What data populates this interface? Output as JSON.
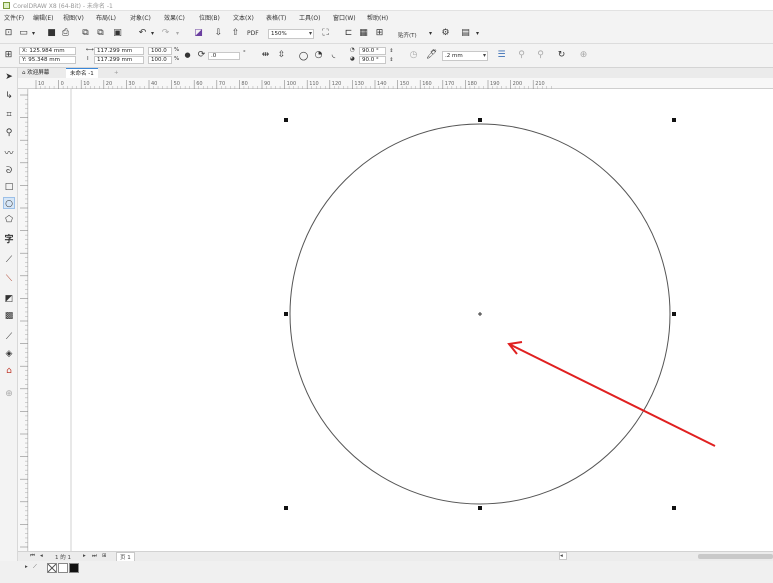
{
  "window": {
    "title": "CorelDRAW X8 (64-Bit) - 未命名 -1"
  },
  "menubar": {
    "items": [
      {
        "label": "文件(F)",
        "name": "menu-file"
      },
      {
        "label": "编辑(E)",
        "name": "menu-edit"
      },
      {
        "label": "视图(V)",
        "name": "menu-view"
      },
      {
        "label": "布局(L)",
        "name": "menu-layout"
      },
      {
        "label": "对象(C)",
        "name": "menu-object"
      },
      {
        "label": "效果(C)",
        "name": "menu-effects"
      },
      {
        "label": "位图(B)",
        "name": "menu-bitmaps"
      },
      {
        "label": "文本(X)",
        "name": "menu-text"
      },
      {
        "label": "表格(T)",
        "name": "menu-table"
      },
      {
        "label": "工具(O)",
        "name": "menu-tools"
      },
      {
        "label": "窗口(W)",
        "name": "menu-window"
      },
      {
        "label": "帮助(H)",
        "name": "menu-help"
      }
    ]
  },
  "toolbar": {
    "zoom": "150%",
    "snap_label": "贴齐(T)"
  },
  "propbar": {
    "x": "X: 125.984 mm",
    "y": "Y: 95.348 mm",
    "width": "117.299 mm",
    "height": "117.299 mm",
    "scale_w": "100.0",
    "scale_h": "100.0",
    "percent": "%",
    "rotation": ".0",
    "degree": "°",
    "start_angle": "90.0 °",
    "end_angle": "90.0 °",
    "outline_width": ".2 mm"
  },
  "doctabs": {
    "welcome": "欢迎屏幕",
    "document": "未命名 -1",
    "add": "+"
  },
  "ruler": {
    "h_labels": [
      "10",
      "0",
      "10",
      "20",
      "30",
      "40",
      "50",
      "60",
      "70",
      "80",
      "90",
      "100",
      "110",
      "120",
      "130",
      "140",
      "150",
      "160",
      "170",
      "180",
      "190",
      "200",
      "210"
    ],
    "unit": "毫米"
  },
  "pagebar": {
    "page_count": "1 的 1",
    "page_tab": "页 1"
  },
  "status": {
    "text": ""
  },
  "colors": {
    "selection_accent": "#3b87d8",
    "arrow": "#e02020",
    "circle_stroke": "#555555"
  }
}
